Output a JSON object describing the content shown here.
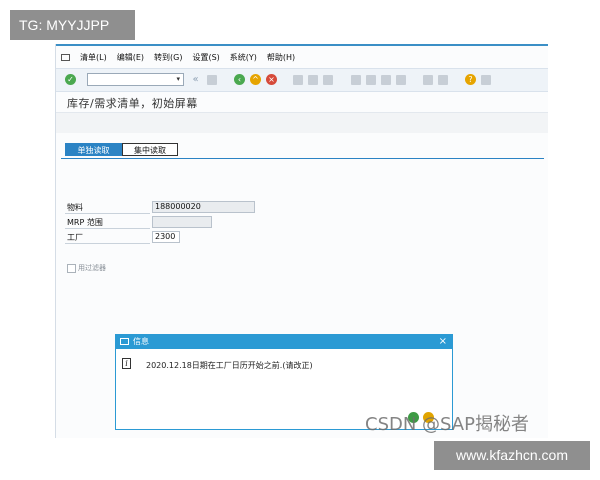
{
  "overlay_tag": "TG: MYYJJPP",
  "overlay_site": "www.kfazhcn.com",
  "watermark": "CSDN @SAP揭秘者",
  "menu": [
    "清单(L)",
    "编辑(E)",
    "转到(G)",
    "设置(S)",
    "系统(Y)",
    "帮助(H)"
  ],
  "toolbar": {
    "command_field": ""
  },
  "screen_title": "库存/需求清单，初始屏幕",
  "tabs": [
    "单独读取",
    "集中读取"
  ],
  "fields": {
    "material": {
      "label": "物料",
      "value": "188000020"
    },
    "mrp_area": {
      "label": "MRP 范围",
      "value": ""
    },
    "plant": {
      "label": "工厂",
      "value": "2300"
    }
  },
  "checkbox": {
    "label": "用过滤器",
    "checked": false
  },
  "dialog": {
    "title": "信息",
    "close": "×",
    "info_icon": "i",
    "message": "2020.12.18日期在工厂日历开始之前.(请改正)"
  },
  "colors": {
    "accent": "#2b9ad4",
    "ok_green": "#3d9a44"
  }
}
